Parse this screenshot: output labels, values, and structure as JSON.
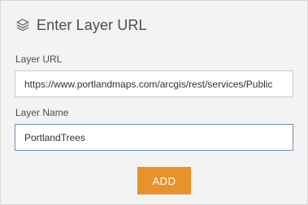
{
  "header": {
    "icon": "layers-icon",
    "title": "Enter Layer URL"
  },
  "form": {
    "layer_url": {
      "label": "Layer URL",
      "value": "https://www.portlandmaps.com/arcgis/rest/services/Public"
    },
    "layer_name": {
      "label": "Layer Name",
      "value": "PortlandTrees"
    },
    "add_label": "ADD"
  },
  "colors": {
    "panel_background": "#f3f3f3",
    "accent_button": "#e8922d",
    "focused_border": "#6d8fb3"
  }
}
